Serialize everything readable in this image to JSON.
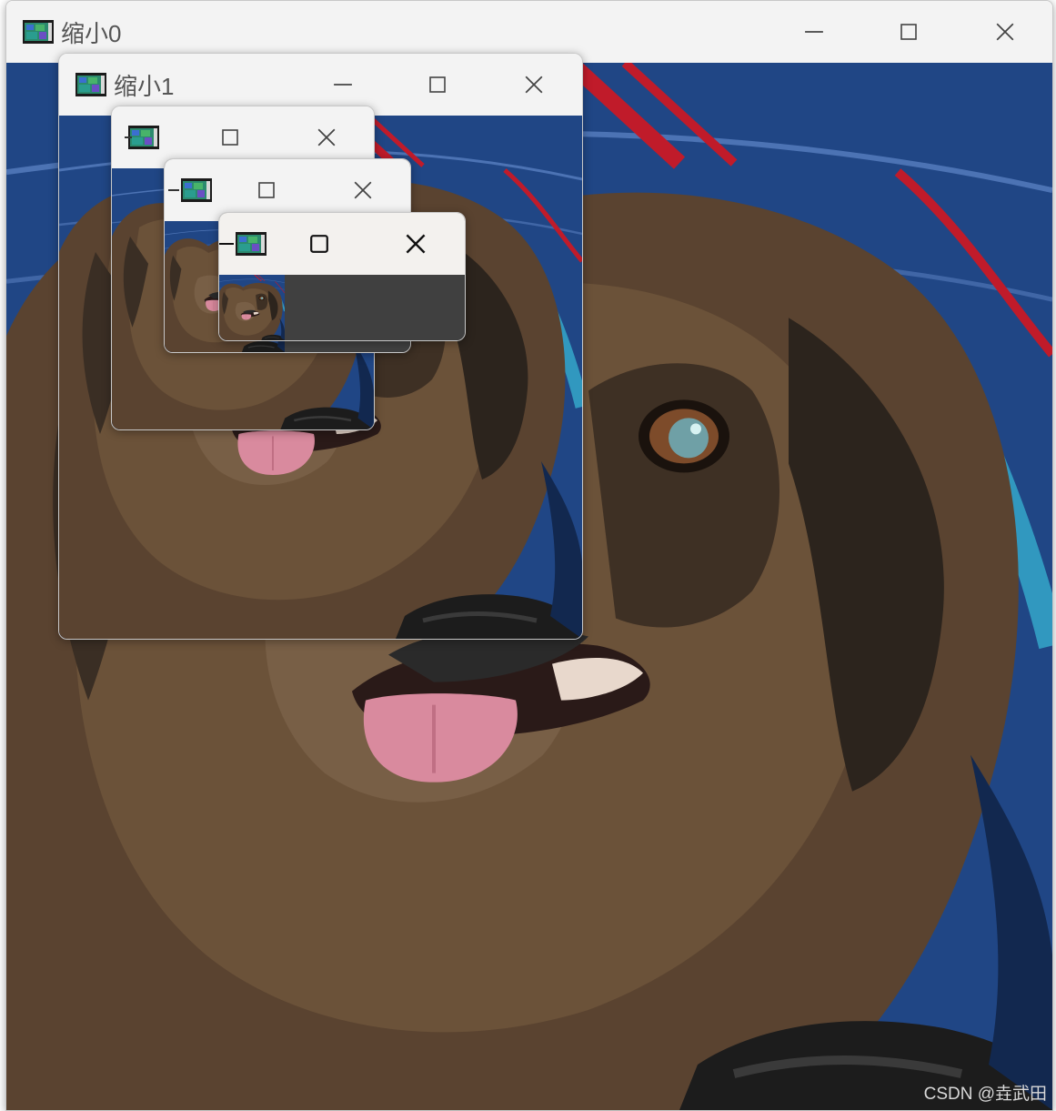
{
  "windows": [
    {
      "id": "w0",
      "title": "缩小0"
    },
    {
      "id": "w1",
      "title": "缩小1"
    },
    {
      "id": "w2",
      "title": ""
    },
    {
      "id": "w3",
      "title": ""
    },
    {
      "id": "w4",
      "title": ""
    }
  ],
  "controls": {
    "minimize_icon": "minimize-icon",
    "maximize_icon": "maximize-icon",
    "close_icon": "close-icon"
  },
  "watermark": "CSDN @垚武田",
  "colors": {
    "titlebar_bg": "#f3f3f3",
    "titlebar_active_bg": "#f3f1ee",
    "empty_area": "#404040"
  }
}
